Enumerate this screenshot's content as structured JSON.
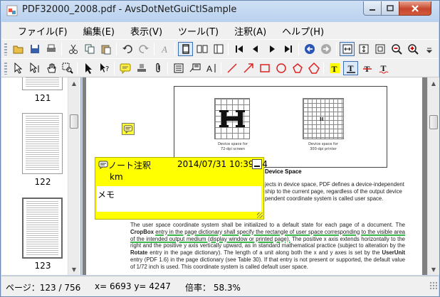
{
  "window": {
    "title": "PDF32000_2008.pdf - AvsDotNetGuiCtlSample"
  },
  "menu": [
    "ファイル(F)",
    "編集(E)",
    "表示(V)",
    "ツール(T)",
    "注釈(A)",
    "ヘルプ(H)"
  ],
  "toolbar1": [
    "open-icon",
    "save-icon",
    "print-icon",
    "cut-icon",
    "copy-icon",
    "paste-icon",
    "undo-icon",
    "redo-icon",
    "text-style-icon",
    "single-page-icon",
    "two-page-icon",
    "thumbnail-panel-icon",
    "first-page-icon",
    "previous-page-icon",
    "next-page-icon",
    "last-page-icon",
    "back-icon",
    "forward-icon",
    "fit-width-icon",
    "fit-height-icon",
    "fit-page-icon",
    "zoom-out-icon",
    "zoom-in-icon"
  ],
  "toolbar2": [
    "select-tool-icon",
    "text-select-icon",
    "hand-tool-icon",
    "marquee-zoom-icon",
    "arrow-select-icon",
    "help-cursor-icon",
    "note-annotation-icon",
    "stamp-icon",
    "attachment-icon",
    "text-box-icon",
    "callout-icon",
    "typewriter-icon",
    "line-icon",
    "arrow-icon",
    "rectangle-icon",
    "ellipse-icon",
    "polygon-icon",
    "cloud-icon",
    "highlight-icon",
    "underline-icon",
    "strikeout-icon",
    "squiggly-icon"
  ],
  "thumbnails": {
    "labels": [
      "121",
      "122",
      "123"
    ]
  },
  "document": {
    "figure_left_caption": "Device space for\n72-dpi screen",
    "figure_right_caption": "Device space for\n300-dpi printer",
    "section_title": "Device Space",
    "para1_lines": [
      "jects in device space, PDF defines a device-independent",
      "ship to the current page, regardless of the output device",
      "pendent coordinate system is called user space."
    ],
    "para2_start": "The user space coordinate system shall be initialized to a default state for each page of a document. The",
    "para2_bold1": "CropBox",
    "para2_underlined": "entry in the page dictionary shall specify the rectangle of user space corresponding to the visible area of the intended output medium (display window or printed page).",
    "para2_mid": "The positive x axis extends horizontally to the right and the positive y axis vertically upward, as in standard mathematical practice (subject to alteration by the",
    "para2_bold2": "Rotate",
    "para2_after_rotate": "entry in the page dictionary). The length of a unit along both the x and y axes is set by the",
    "para2_bold3": "UserUnit",
    "para2_end": "entry (PDF 1.6) in the page dictionary (see Table 30). If that entry is not present or supported, the default value of 1/72 inch is used. This coordinate system is called default user space."
  },
  "note": {
    "title": "ノート注釈",
    "date": "2014/07/31 10:39:54",
    "author": "km",
    "body": "メモ"
  },
  "status": {
    "page": "ページ：123 / 756",
    "coords": "x= 6693 y= 4247",
    "zoom": "倍率：  58.3%"
  }
}
